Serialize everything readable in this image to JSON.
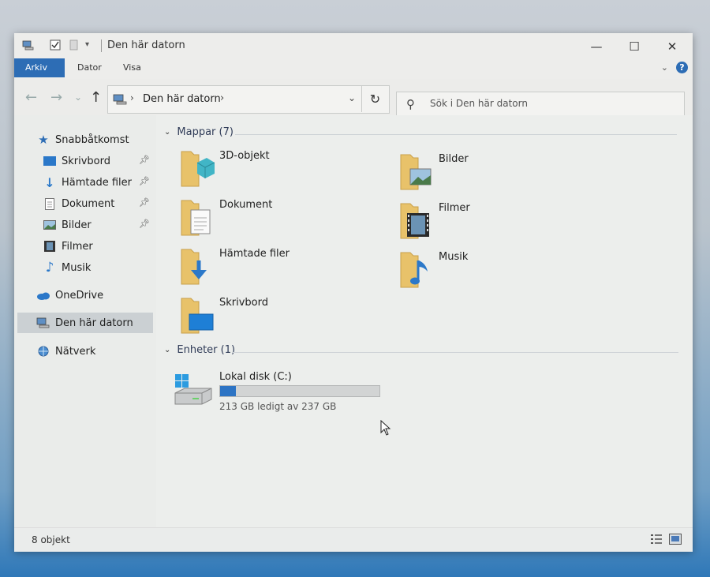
{
  "window": {
    "title": "Den här datorn",
    "controls": {
      "minimize": "—",
      "maximize": "☐",
      "close": "✕"
    }
  },
  "ribbon": {
    "tabs": [
      {
        "label": "Arkiv",
        "active": true
      },
      {
        "label": "Dator",
        "active": false
      },
      {
        "label": "Visa",
        "active": false
      }
    ],
    "help": "?"
  },
  "navbar": {
    "back": "←",
    "forward": "→",
    "recent": "⌄",
    "up": "↑",
    "address": "Den här datorn",
    "refresh": "↻",
    "search_placeholder": "Sök i Den här datorn"
  },
  "sidebar": {
    "quick_access": "Snabbåtkomst",
    "items": [
      {
        "label": "Skrivbord",
        "icon": "desktop-icon",
        "pinned": true
      },
      {
        "label": "Hämtade filer",
        "icon": "download-icon",
        "pinned": true
      },
      {
        "label": "Dokument",
        "icon": "document-icon",
        "pinned": true
      },
      {
        "label": "Bilder",
        "icon": "pictures-icon",
        "pinned": true
      },
      {
        "label": "Filmer",
        "icon": "film-icon",
        "pinned": false
      },
      {
        "label": "Musik",
        "icon": "music-icon",
        "pinned": false
      }
    ],
    "onedrive": "OneDrive",
    "this_pc": "Den här datorn",
    "network": "Nätverk"
  },
  "content": {
    "folders_header": "Mappar (7)",
    "folders": [
      {
        "name": "3D-objekt",
        "icon": "3d-objects-folder-icon"
      },
      {
        "name": "Bilder",
        "icon": "pictures-folder-icon"
      },
      {
        "name": "Dokument",
        "icon": "documents-folder-icon"
      },
      {
        "name": "Filmer",
        "icon": "videos-folder-icon"
      },
      {
        "name": "Hämtade filer",
        "icon": "downloads-folder-icon"
      },
      {
        "name": "Musik",
        "icon": "music-folder-icon"
      },
      {
        "name": "Skrivbord",
        "icon": "desktop-folder-icon"
      }
    ],
    "devices_header": "Enheter (1)",
    "drive": {
      "name": "Lokal disk (C:)",
      "free_text": "213 GB ledigt av 237 GB",
      "used_fraction": 0.1
    }
  },
  "status": {
    "count": "8 objekt"
  },
  "colors": {
    "accent": "#2d6db5",
    "drive_fill": "#2d74c4",
    "folder": "#e8c26a"
  }
}
